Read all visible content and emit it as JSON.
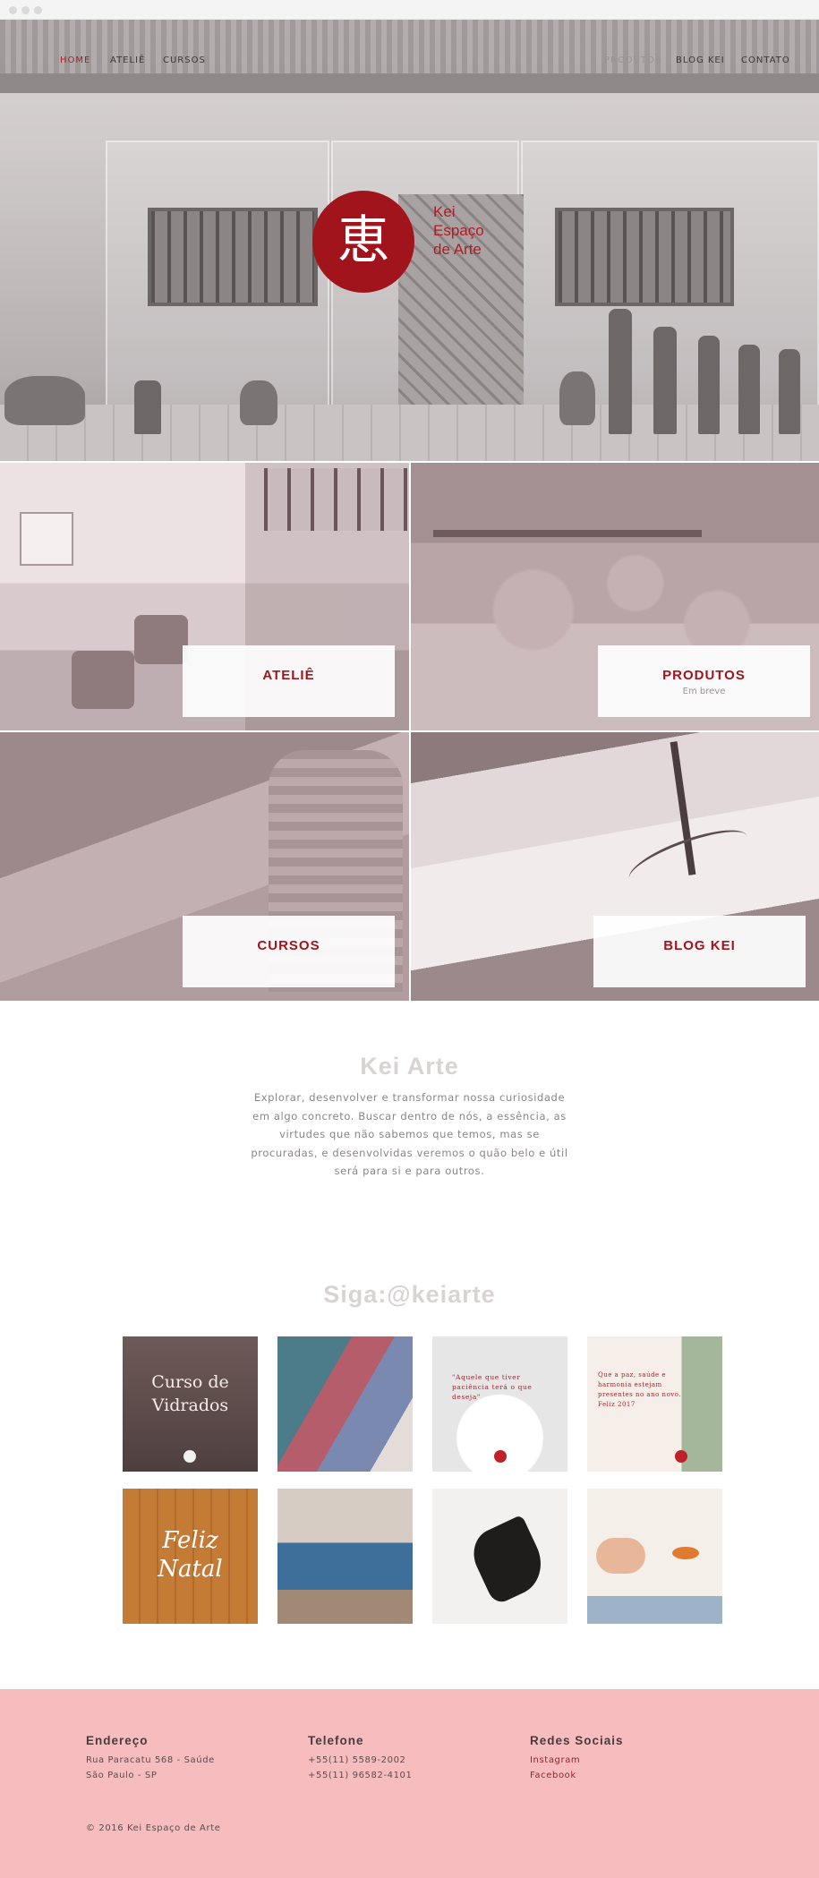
{
  "colors": {
    "brand_red": "#a2141c",
    "footer_pink": "#f6bcbe"
  },
  "nav": {
    "home": "HOME",
    "atelie": "ATELIÊ",
    "cursos": "CURSOS",
    "produtos": "PRODUTOS",
    "blog": "BLOG KEI",
    "contato": "CONTATO"
  },
  "logo": {
    "kanji": "恵",
    "line1": "Kei",
    "line2": "Espaço",
    "line3": "de Arte"
  },
  "tiles": [
    {
      "title": "ATELIÊ",
      "subtitle": ""
    },
    {
      "title": "PRODUTOS",
      "subtitle": "Em breve"
    },
    {
      "title": "CURSOS",
      "subtitle": ""
    },
    {
      "title": "BLOG KEI",
      "subtitle": ""
    }
  ],
  "about": {
    "title": "Kei Arte",
    "text": "Explorar, desenvolver e transformar nossa curiosidade em algo concreto. Buscar dentro de nós, a essência, as virtudes que não sabemos que temos, mas se procuradas, e desenvolvidas veremos o quão belo e útil será para si e para outros."
  },
  "instagram": {
    "title": "Siga:@keiarte",
    "posts": [
      {
        "caption": "Curso de Vidrados"
      },
      {
        "caption": ""
      },
      {
        "caption": "\"Aquele que tiver paciência terá o que deseja\""
      },
      {
        "caption": "Que a paz, saúde e harmonia estejam presentes no ano novo. Feliz 2017"
      },
      {
        "caption": "Feliz Natal"
      },
      {
        "caption": ""
      },
      {
        "caption": ""
      },
      {
        "caption": ""
      }
    ]
  },
  "footer": {
    "address_title": "Endereço",
    "address_line1": "Rua Paracatu 568 - Saúde",
    "address_line2": "São Paulo - SP",
    "phone_title": "Telefone",
    "phone1": "+55(11) 5589-2002",
    "phone2": "+55(11) 96582-4101",
    "social_title": "Redes Sociais",
    "instagram": "Instagram",
    "facebook": "Facebook",
    "copyright": "© 2016 Kei Espaço de Arte"
  }
}
